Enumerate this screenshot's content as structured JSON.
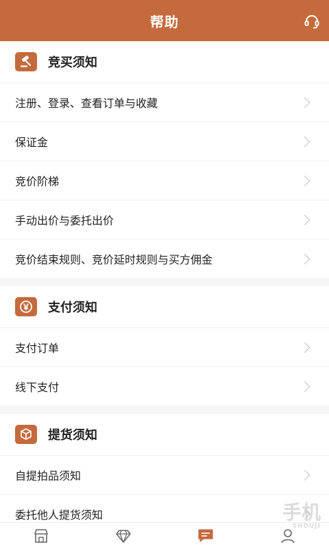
{
  "header": {
    "title": "帮助",
    "support_icon": "headset-icon",
    "bg_color": "#c46a3d"
  },
  "sections": [
    {
      "title": "竞买须知",
      "icon": "gavel-icon",
      "items": [
        {
          "label": "注册、登录、查看订单与收藏"
        },
        {
          "label": "保证金"
        },
        {
          "label": "竞价阶梯"
        },
        {
          "label": "手动出价与委托出价"
        },
        {
          "label": "竞价结束规则、竞价延时规则与买方佣金"
        }
      ]
    },
    {
      "title": "支付须知",
      "icon": "yuan-icon",
      "items": [
        {
          "label": "支付订单"
        },
        {
          "label": "线下支付"
        }
      ]
    },
    {
      "title": "提货须知",
      "icon": "package-icon",
      "items": [
        {
          "label": "自提拍品须知"
        },
        {
          "label": "委托他人提货须知"
        }
      ]
    }
  ],
  "tabbar": {
    "tabs": [
      {
        "icon": "store-icon",
        "active": false
      },
      {
        "icon": "diamond-icon",
        "active": false
      },
      {
        "icon": "message-icon",
        "active": true
      },
      {
        "icon": "user-icon",
        "active": false
      }
    ],
    "active_color": "#c46a3d",
    "inactive_color": "#666666"
  },
  "watermark": {
    "main": "手机",
    "sub": "SHOUJI"
  }
}
